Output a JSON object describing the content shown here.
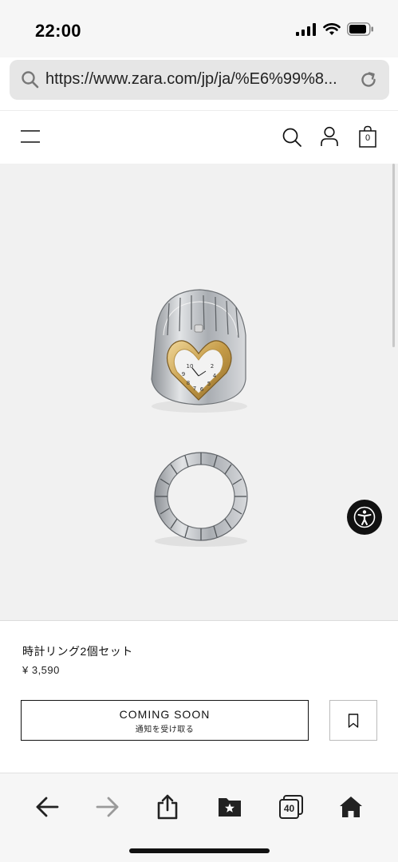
{
  "status_bar": {
    "time": "22:00",
    "icons": [
      "signal-icon",
      "wifi-icon",
      "battery-icon"
    ]
  },
  "browser": {
    "url": "https://www.zara.com/jp/ja/%E6%99%8...",
    "tab_count": "40"
  },
  "header": {
    "bag_count": "0",
    "icons": [
      "menu-icon",
      "search-icon",
      "account-icon",
      "bag-icon"
    ]
  },
  "product": {
    "name": "時計リング2個セット",
    "price": "¥ 3,590",
    "primary_button": {
      "label": "COMING SOON",
      "sublabel": "通知を受け取る"
    }
  },
  "toolbar": {
    "icons": [
      "back-arrow-icon",
      "forward-arrow-icon",
      "share-icon",
      "bookmarks-icon",
      "tabs-icon",
      "home-icon"
    ]
  },
  "colors": {
    "accent": "#111111",
    "image_bg": "#f1f1f1",
    "ring_silver": "#b9bcc0",
    "ring_gold": "#c9a45a"
  }
}
